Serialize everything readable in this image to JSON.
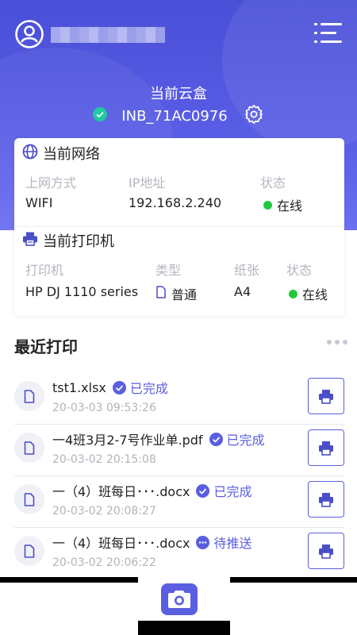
{
  "header": {
    "box_title": "当前云盒",
    "box_id": "INB_71AC0976"
  },
  "network": {
    "title": "当前网络",
    "labels": [
      "上网方式",
      "IP地址",
      "状态"
    ],
    "method": "WIFI",
    "ip": "192.168.2.240",
    "status": "在线"
  },
  "printer": {
    "title": "当前打印机",
    "labels": [
      "打印机",
      "类型",
      "纸张",
      "状态"
    ],
    "name": "HP DJ 1110 series",
    "type": "普通",
    "paper": "A4",
    "status": "在线"
  },
  "recent": {
    "title": "最近打印",
    "items": [
      {
        "name": "tst1.xlsx",
        "status": "已完成",
        "time": "20-03-03 09:53:26"
      },
      {
        "name": "一4班3月2-7号作业单.pdf",
        "status": "已完成",
        "time": "20-03-02 20:15:08"
      },
      {
        "name": "一（4）班每日･･･.docx",
        "status": "已完成",
        "time": "20-03-02 20:08:27"
      },
      {
        "name": "一（4）班每日･･･.docx",
        "status": "待推送",
        "time": "20-03-02 20:06:22"
      }
    ]
  },
  "colors": {
    "accent": "#5a5ee0",
    "online": "#22c83c",
    "header_bg": "#5055dd"
  }
}
